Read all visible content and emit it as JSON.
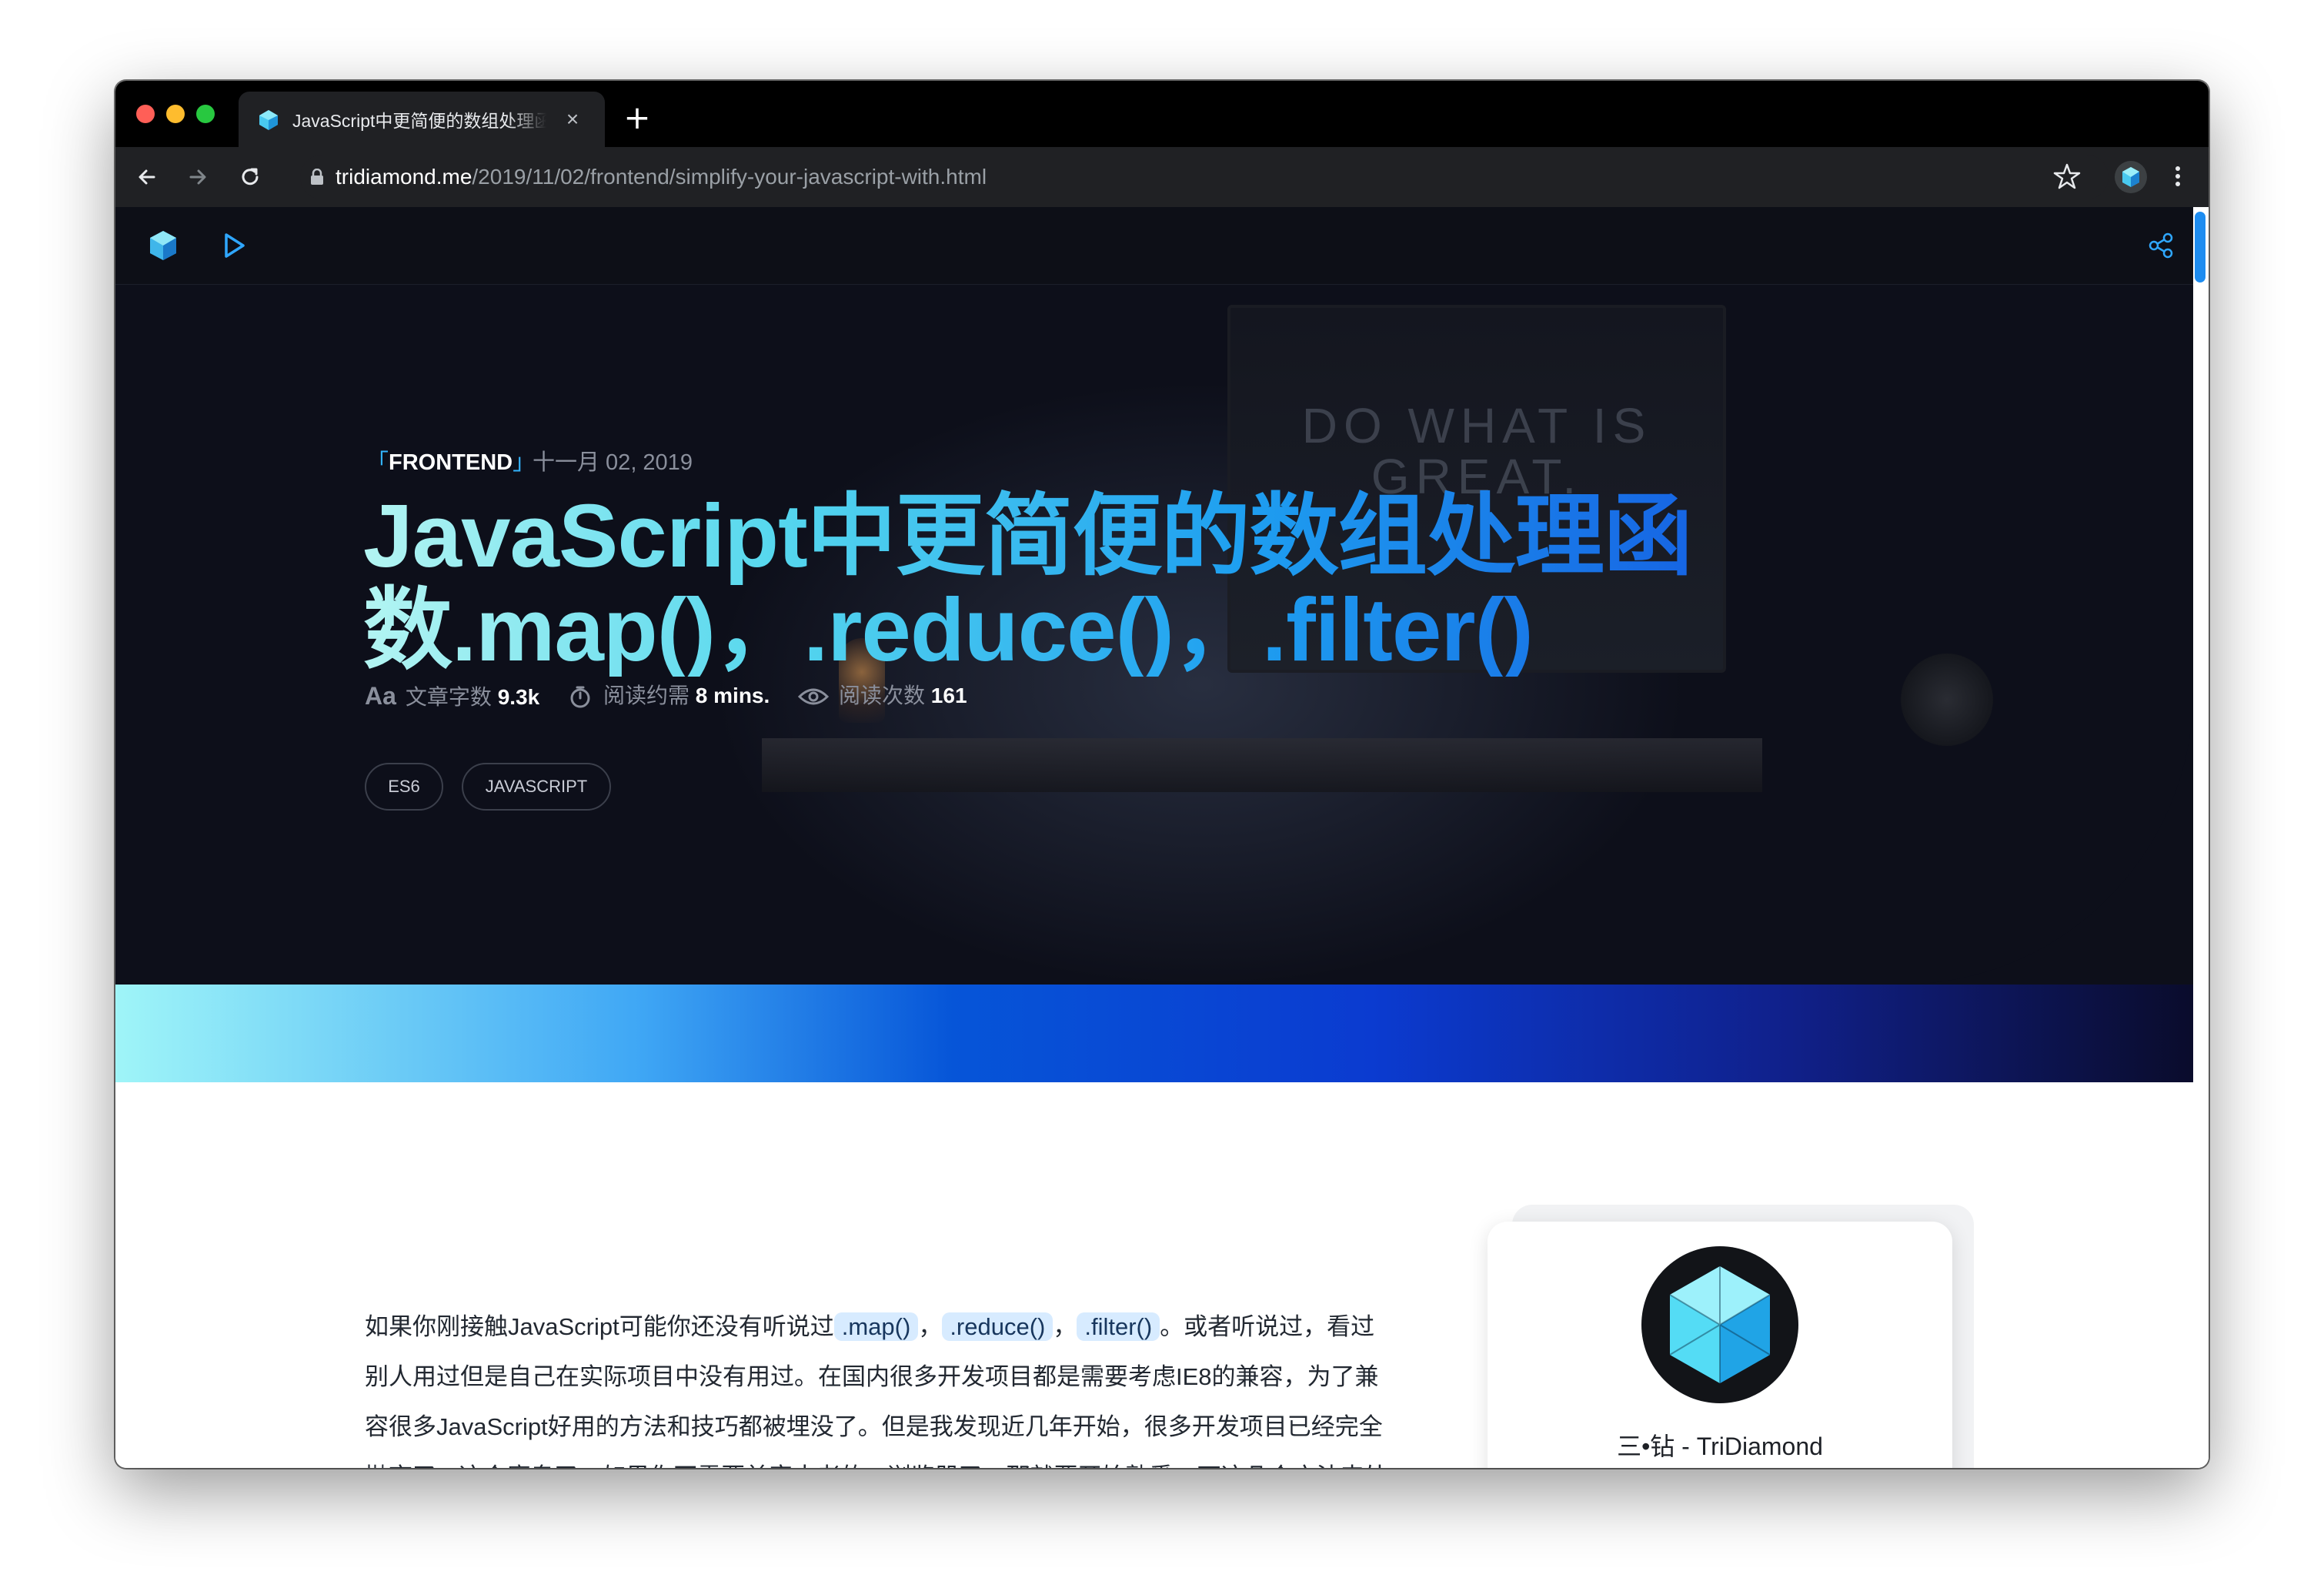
{
  "browser": {
    "tab_title": "JavaScript中更简便的数组处理函数.map()，.reduce()，.filter()",
    "url_host": "tridiamond.me",
    "url_path": "/2019/11/02/frontend/simplify-your-javascript-with.html",
    "icons": [
      "close-icon",
      "plus-icon",
      "back-icon",
      "forward-icon",
      "reload-icon",
      "lock-icon",
      "star-icon",
      "extension-icon",
      "more-icon"
    ]
  },
  "site_nav": {
    "icons": [
      "tridiamond-logo-icon",
      "play-icon",
      "share-icon"
    ]
  },
  "hero": {
    "category_open": "「",
    "category": "FRONTEND",
    "category_close": "」",
    "date": "十一月 02, 2019",
    "title_line1": "JavaScript中更简便的数组处理函",
    "title_line2": "数.map()，.reduce()，.filter()",
    "background_text": "DO WHAT IS GREAT.",
    "meta": {
      "words_icon": "Aa",
      "words_label": "文章字数",
      "words_value": "9.3k",
      "time_label": "阅读约需",
      "time_value": "8 mins.",
      "views_label": "阅读次数",
      "views_value": "161"
    },
    "tags": [
      "ES6",
      "JAVASCRIPT"
    ]
  },
  "article": {
    "p1_a": "如果你刚接触JavaScript可能你还没有听说过",
    "code1": ".map()",
    "sep1": "，",
    "code2": ".reduce()",
    "sep2": "，",
    "code3": ".filter()",
    "p1_b": "。或者听说过，看过别人用过但是自己在实际项目中没有用过。在国内很多开发项目都是需要考虑IE8的兼容，为了兼容很多JavaScript好用的方法和技巧都被埋没了。但是我发现近几年开始，很多开发项目已经完全抛弃了IE这个魔鬼了。如果你不需要兼容古老的IE浏览器了，那就要开始熟悉一下这几个方法来处理数组。"
  },
  "author_card": {
    "name": "三•钻 - TriDiamond"
  },
  "colors": {
    "accent": "#1d8cf0",
    "title_gradient_start": "#b3f5f2",
    "title_gradient_end": "#1454e0",
    "hero_bg": "#0d0f1a",
    "code_bg": "#d7ebff"
  }
}
